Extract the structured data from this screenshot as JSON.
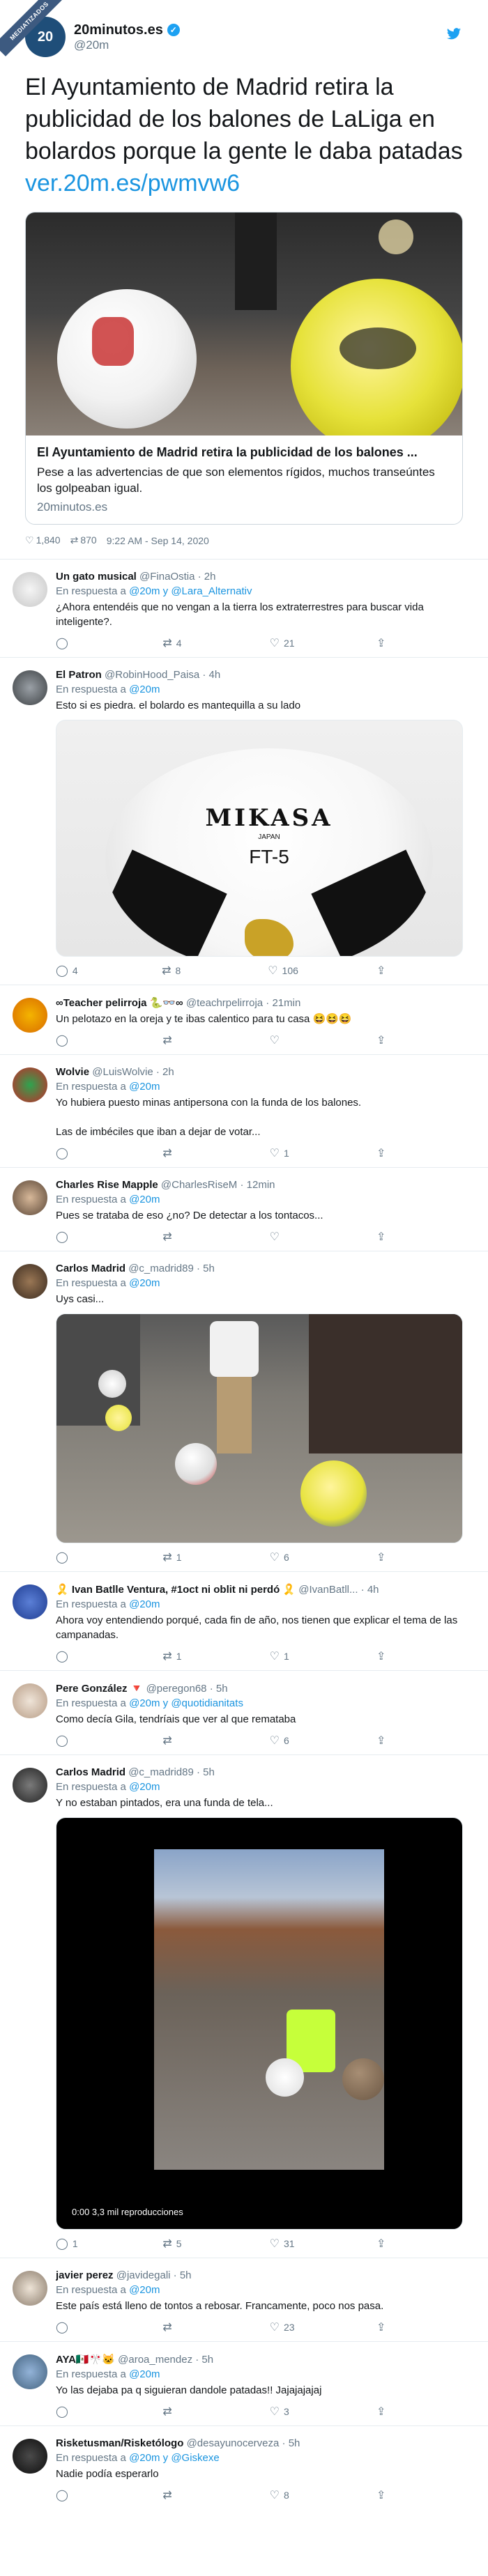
{
  "main_tweet": {
    "corner_label": "MEDIATIZADOS",
    "avatar_text": "20",
    "account_name": "20minutos.es",
    "handle": "@20m",
    "text": "El Ayuntamiento de Madrid retira la publicidad de los balones de LaLiga en bolardos porque la gente le daba patadas",
    "link": "ver.20m.es/pwmvw6",
    "card": {
      "title": "El Ayuntamiento de Madrid retira la publicidad de los balones ...",
      "description": "Pese a las advertencias de que son elementos rígidos, muchos transeúntes los golpeaban igual.",
      "domain": "20minutos.es"
    },
    "likes": "1,840",
    "retweets": "870",
    "timestamp": "9:22 AM - Sep 14, 2020"
  },
  "replies": [
    {
      "name": "Un gato musical",
      "handle": "@FinaOstia · 2h",
      "reply_to": "@20m y @Lara_Alternativ",
      "text": "¿Ahora entendéis que no vengan a la tierra los extraterrestres para buscar vida inteligente?.",
      "replies": "",
      "retweets": "4",
      "likes": "21"
    },
    {
      "name": "El Patron",
      "handle": "@RobinHood_Paisa · 4h",
      "reply_to": "@20m",
      "text": "Esto si es piedra. el bolardo es mantequilla a su lado",
      "media_logo": "MIKASA",
      "media_logo_sub": "JAPAN",
      "media_model": "FT-5",
      "replies": "4",
      "retweets": "8",
      "likes": "106"
    },
    {
      "name": "∞Teacher pelirroja 🐍👓∞",
      "handle": "@teachrpelirroja · 21min",
      "reply_to": "",
      "text": "Un pelotazo en la oreja y te ibas calentico para tu casa 😆😆😆",
      "replies": "",
      "retweets": "",
      "likes": ""
    },
    {
      "name": "Wolvie",
      "handle": "@LuisWolvie · 2h",
      "reply_to": "@20m",
      "text": "Yo hubiera puesto minas antipersona con la funda de los balones.\n\nLas de imbéciles que iban a dejar de votar...",
      "replies": "",
      "retweets": "",
      "likes": "1"
    },
    {
      "name": "Charles Rise Mapple",
      "handle": "@CharlesRiseM · 12min",
      "reply_to": "@20m",
      "text": "Pues se trataba de eso ¿no? De detectar a los tontacos...",
      "replies": "",
      "retweets": "",
      "likes": ""
    },
    {
      "name": "Carlos Madrid",
      "handle": "@c_madrid89 · 5h",
      "reply_to": "@20m",
      "text": "Uys casi...",
      "replies": "",
      "retweets": "1",
      "likes": "6"
    },
    {
      "name": "🎗️ Ivan Batlle Ventura, #1oct ni oblit ni perdó 🎗️",
      "handle": "@IvanBatll... · 4h",
      "reply_to": "@20m",
      "text": "Ahora voy entendiendo porqué, cada fin de año, nos tienen que explicar el tema de las campanadas.",
      "replies": "",
      "retweets": "1",
      "likes": "1"
    },
    {
      "name": "Pere González 🔻",
      "handle": "@peregon68 · 5h",
      "reply_to": "@20m y @quotidianitats",
      "text": "Como decía Gila, tendríais que ver al que remataba",
      "replies": "",
      "retweets": "",
      "likes": "6"
    },
    {
      "name": "Carlos Madrid",
      "handle": "@c_madrid89 · 5h",
      "reply_to": "@20m",
      "text": "Y no estaban pintados, era una funda de tela...",
      "video_badge": "0:00   3,3 mil reproducciones",
      "replies": "1",
      "retweets": "5",
      "likes": "31"
    },
    {
      "name": "javier perez",
      "handle": "@javidegali · 5h",
      "reply_to": "@20m",
      "text": "Este país está lleno de tontos a rebosar. Francamente, poco nos pasa.",
      "replies": "",
      "retweets": "",
      "likes": "23"
    },
    {
      "name": "AYA🇲🇽🎌🐱",
      "handle": "@aroa_mendez · 5h",
      "reply_to": "@20m",
      "text": "Yo las dejaba pa q siguieran dandole patadas!! Jajajajajaj",
      "replies": "",
      "retweets": "",
      "likes": "3"
    },
    {
      "name": "Risketusman/Risketólogo",
      "handle": "@desayunocerveza · 5h",
      "reply_to": "@20m y @Giskexe",
      "text": "Nadie podía esperarlo",
      "replies": "",
      "retweets": "",
      "likes": "8"
    }
  ],
  "labels": {
    "in_reply_to": "En respuesta a"
  },
  "colors": {
    "accent": "#1da1f2",
    "link": "#1b95e0",
    "muted": "#657786"
  },
  "icons": [
    "reply-icon",
    "retweet-icon",
    "like-icon",
    "share-icon",
    "twitter-bird-icon",
    "verified-icon"
  ]
}
